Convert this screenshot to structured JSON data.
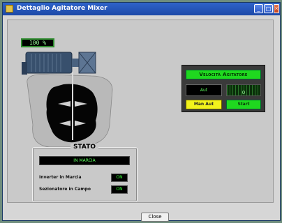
{
  "window": {
    "title": "Dettaglio Agitatore Mixer",
    "minimize_icon": "minimize-icon",
    "maximize_icon": "maximize-icon",
    "close_icon": "close-icon"
  },
  "motor": {
    "speed_display": "100 %"
  },
  "velocity_panel": {
    "title": "Velocità Agitatore",
    "mode_display": "Aut",
    "auto_label": "",
    "auto_value": "0",
    "man_aut_button": "Man   Aut",
    "start_button": "Start"
  },
  "stato": {
    "title": "STATO",
    "display": "IN MARCIA",
    "rows": [
      {
        "label": "Inverter in Marcia",
        "value": "ON"
      },
      {
        "label": "Sezionatore in Campo",
        "value": "ON"
      }
    ]
  },
  "footer": {
    "close_button": "Close"
  },
  "colors": {
    "led_green": "#1fd81f",
    "button_yellow": "#f2f21c",
    "titlebar_blue": "#2f63c9",
    "display_black": "#000000"
  }
}
